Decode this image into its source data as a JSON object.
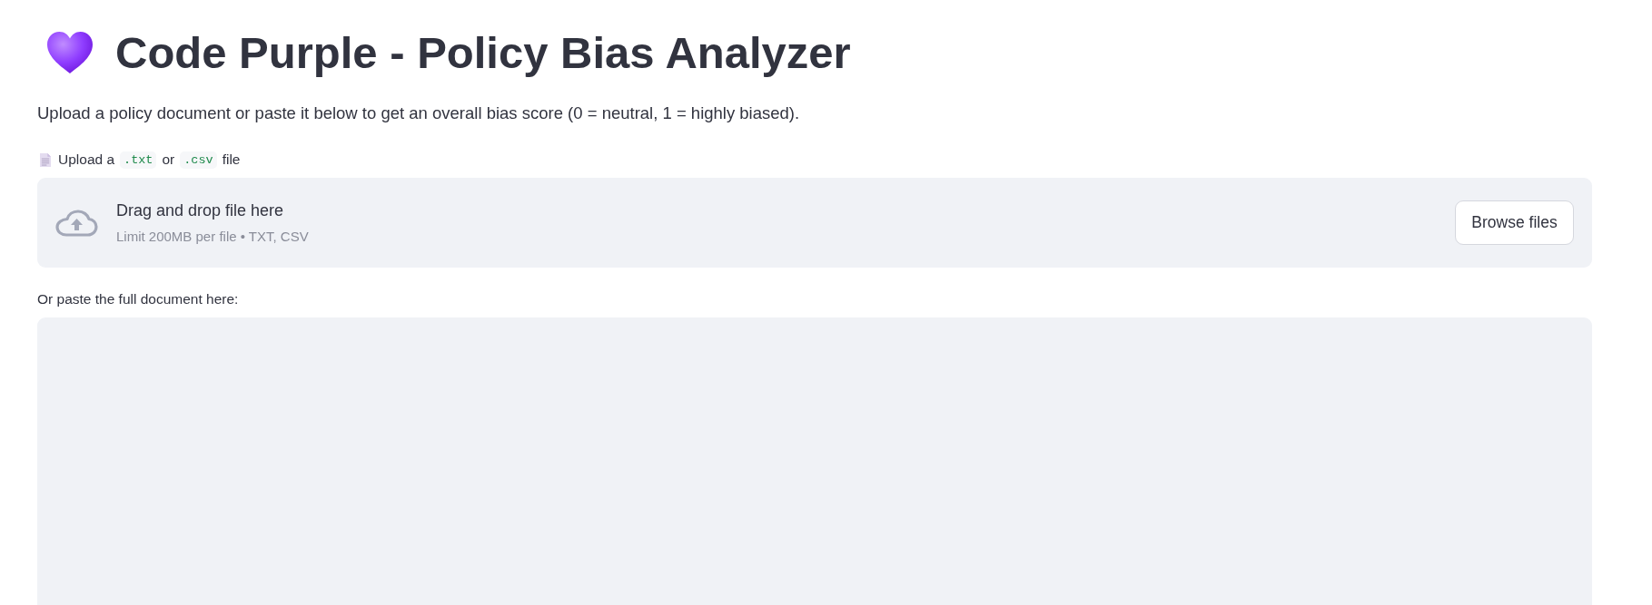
{
  "header": {
    "title": "Code Purple - Policy Bias Analyzer"
  },
  "description": "Upload a policy document or paste it below to get an overall bias score (0 = neutral, 1 = highly biased).",
  "file_uploader": {
    "label_parts": [
      {
        "kind": "text",
        "text": "Upload a"
      },
      {
        "kind": "code",
        "text": ".txt"
      },
      {
        "kind": "text",
        "text": "or"
      },
      {
        "kind": "code",
        "text": ".csv"
      },
      {
        "kind": "text",
        "text": "file"
      }
    ],
    "instruction": "Drag and drop file here",
    "limit": "Limit 200MB per file • TXT, CSV",
    "button": "Browse files"
  },
  "paste_field": {
    "label": "Or paste the full document here:"
  }
}
